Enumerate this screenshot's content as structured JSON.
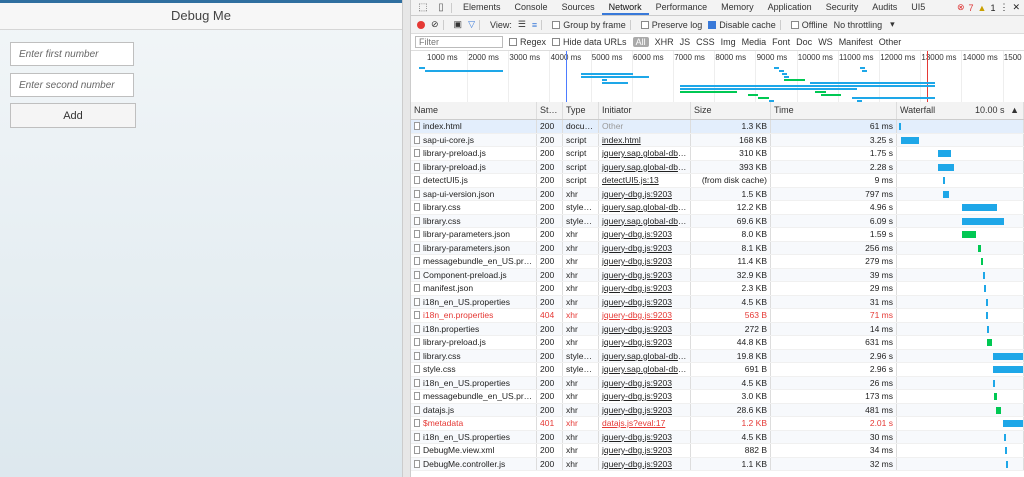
{
  "app": {
    "title": "Debug Me",
    "first_placeholder": "Enter first number",
    "second_placeholder": "Enter second number",
    "add_label": "Add"
  },
  "devtools": {
    "tabs": [
      "Elements",
      "Console",
      "Sources",
      "Network",
      "Performance",
      "Memory",
      "Application",
      "Security",
      "Audits",
      "UI5"
    ],
    "active_tab": "Network",
    "errors": "7",
    "warnings": "1",
    "toolbar": {
      "view_label": "View:",
      "group_by_frame": "Group by frame",
      "preserve_log": "Preserve log",
      "disable_cache": "Disable cache",
      "offline": "Offline",
      "throttling": "No throttling"
    },
    "filter": {
      "placeholder": "Filter",
      "regex": "Regex",
      "hide_data_urls": "Hide data URLs",
      "types": [
        "All",
        "XHR",
        "JS",
        "CSS",
        "Img",
        "Media",
        "Font",
        "Doc",
        "WS",
        "Manifest",
        "Other"
      ]
    },
    "overview_ticks": [
      "1000 ms",
      "2000 ms",
      "3000 ms",
      "4000 ms",
      "5000 ms",
      "6000 ms",
      "7000 ms",
      "8000 ms",
      "9000 ms",
      "10000 ms",
      "11000 ms",
      "12000 ms",
      "13000 ms",
      "14000 ms",
      "1500"
    ],
    "columns": {
      "name": "Name",
      "status": "Stat...",
      "type": "Type",
      "initiator": "Initiator",
      "size": "Size",
      "time": "Time",
      "waterfall": "Waterfall",
      "waterfall_tick": "10.00 s"
    },
    "requests": [
      {
        "name": "index.html",
        "status": "200",
        "type": "docum...",
        "initiator": "Other",
        "size": "1.3 KB",
        "time": "61 ms",
        "wf_start": 0.8,
        "wf_len": 1.2,
        "color": "#1ea7e8"
      },
      {
        "name": "sap-ui-core.js",
        "status": "200",
        "type": "script",
        "initiator": "index.html",
        "size": "168 KB",
        "time": "3.25 s",
        "wf_start": 2,
        "wf_len": 15,
        "color": "#1ea7e8"
      },
      {
        "name": "library-preload.js",
        "status": "200",
        "type": "script",
        "initiator": "jquery.sap.global-dbg.j...",
        "size": "310 KB",
        "time": "1.75 s",
        "wf_start": 32,
        "wf_len": 10,
        "color": "#1ea7e8"
      },
      {
        "name": "library-preload.js",
        "status": "200",
        "type": "script",
        "initiator": "jquery.sap.global-dbg.j...",
        "size": "393 KB",
        "time": "2.28 s",
        "wf_start": 32,
        "wf_len": 13,
        "color": "#1ea7e8"
      },
      {
        "name": "detectUI5.js",
        "status": "200",
        "type": "script",
        "initiator": "detectUI5.js:13",
        "size": "(from disk cache)",
        "time": "9 ms",
        "wf_start": 36,
        "wf_len": 1,
        "color": "#1ea7e8"
      },
      {
        "name": "sap-ui-version.json",
        "status": "200",
        "type": "xhr",
        "initiator": "jquery-dbg.js:9203",
        "size": "1.5 KB",
        "time": "797 ms",
        "wf_start": 36,
        "wf_len": 5,
        "color": "#1ea7e8"
      },
      {
        "name": "library.css",
        "status": "200",
        "type": "stylesh...",
        "initiator": "jquery.sap.global-dbg.j...",
        "size": "12.2 KB",
        "time": "4.96 s",
        "wf_start": 51,
        "wf_len": 28,
        "color": "#1ea7e8"
      },
      {
        "name": "library.css",
        "status": "200",
        "type": "stylesh...",
        "initiator": "jquery.sap.global-dbg.j...",
        "size": "69.6 KB",
        "time": "6.09 s",
        "wf_start": 51,
        "wf_len": 34,
        "color": "#1ea7e8"
      },
      {
        "name": "library-parameters.json",
        "status": "200",
        "type": "xhr",
        "initiator": "jquery-dbg.js:9203",
        "size": "8.0 KB",
        "time": "1.59 s",
        "wf_start": 51,
        "wf_len": 11,
        "color": "#00c853"
      },
      {
        "name": "library-parameters.json",
        "status": "200",
        "type": "xhr",
        "initiator": "jquery-dbg.js:9203",
        "size": "8.1 KB",
        "time": "256 ms",
        "wf_start": 64,
        "wf_len": 2,
        "color": "#00c853"
      },
      {
        "name": "messagebundle_en_US.proper...",
        "status": "200",
        "type": "xhr",
        "initiator": "jquery-dbg.js:9203",
        "size": "11.4 KB",
        "time": "279 ms",
        "wf_start": 66,
        "wf_len": 2,
        "color": "#00c853"
      },
      {
        "name": "Component-preload.js",
        "status": "200",
        "type": "xhr",
        "initiator": "jquery-dbg.js:9203",
        "size": "32.9 KB",
        "time": "39 ms",
        "wf_start": 68,
        "wf_len": 1,
        "color": "#1ea7e8"
      },
      {
        "name": "manifest.json",
        "status": "200",
        "type": "xhr",
        "initiator": "jquery-dbg.js:9203",
        "size": "2.3 KB",
        "time": "29 ms",
        "wf_start": 69,
        "wf_len": 1,
        "color": "#1ea7e8"
      },
      {
        "name": "i18n_en_US.properties",
        "status": "200",
        "type": "xhr",
        "initiator": "jquery-dbg.js:9203",
        "size": "4.5 KB",
        "time": "31 ms",
        "wf_start": 70,
        "wf_len": 1,
        "color": "#1ea7e8"
      },
      {
        "name": "i18n_en.properties",
        "status": "404",
        "type": "xhr",
        "initiator": "jquery-dbg.js:9203",
        "size": "563 B",
        "time": "71 ms",
        "wf_start": 70.5,
        "wf_len": 1,
        "color": "#1ea7e8",
        "error": true
      },
      {
        "name": "i18n.properties",
        "status": "200",
        "type": "xhr",
        "initiator": "jquery-dbg.js:9203",
        "size": "272 B",
        "time": "14 ms",
        "wf_start": 71,
        "wf_len": 1,
        "color": "#1ea7e8"
      },
      {
        "name": "library-preload.js",
        "status": "200",
        "type": "xhr",
        "initiator": "jquery-dbg.js:9203",
        "size": "44.8 KB",
        "time": "631 ms",
        "wf_start": 71,
        "wf_len": 4,
        "color": "#00c853"
      },
      {
        "name": "library.css",
        "status": "200",
        "type": "stylesh...",
        "initiator": "jquery.sap.global-dbg.j...",
        "size": "19.8 KB",
        "time": "2.96 s",
        "wf_start": 76,
        "wf_len": 24,
        "color": "#1ea7e8"
      },
      {
        "name": "style.css",
        "status": "200",
        "type": "stylesh...",
        "initiator": "jquery.sap.global-dbg.j...",
        "size": "691 B",
        "time": "2.96 s",
        "wf_start": 76,
        "wf_len": 24,
        "color": "#1ea7e8"
      },
      {
        "name": "i18n_en_US.properties",
        "status": "200",
        "type": "xhr",
        "initiator": "jquery-dbg.js:9203",
        "size": "4.5 KB",
        "time": "26 ms",
        "wf_start": 76,
        "wf_len": 1,
        "color": "#1ea7e8"
      },
      {
        "name": "messagebundle_en_US.proper...",
        "status": "200",
        "type": "xhr",
        "initiator": "jquery-dbg.js:9203",
        "size": "3.0 KB",
        "time": "173 ms",
        "wf_start": 77,
        "wf_len": 2,
        "color": "#00c853"
      },
      {
        "name": "datajs.js",
        "status": "200",
        "type": "xhr",
        "initiator": "jquery-dbg.js:9203",
        "size": "28.6 KB",
        "time": "481 ms",
        "wf_start": 78,
        "wf_len": 4,
        "color": "#00c853"
      },
      {
        "name": "$metadata",
        "status": "401",
        "type": "xhr",
        "initiator": "datajs.js?eval:17",
        "size": "1.2 KB",
        "time": "2.01 s",
        "wf_start": 84,
        "wf_len": 16,
        "color": "#1ea7e8",
        "error": true
      },
      {
        "name": "i18n_en_US.properties",
        "status": "200",
        "type": "xhr",
        "initiator": "jquery-dbg.js:9203",
        "size": "4.5 KB",
        "time": "30 ms",
        "wf_start": 85,
        "wf_len": 1,
        "color": "#1ea7e8"
      },
      {
        "name": "DebugMe.view.xml",
        "status": "200",
        "type": "xhr",
        "initiator": "jquery-dbg.js:9203",
        "size": "882 B",
        "time": "34 ms",
        "wf_start": 85.5,
        "wf_len": 1,
        "color": "#1ea7e8"
      },
      {
        "name": "DebugMe.controller.js",
        "status": "200",
        "type": "xhr",
        "initiator": "jquery-dbg.js:9203",
        "size": "1.1 KB",
        "time": "32 ms",
        "wf_start": 86,
        "wf_len": 1,
        "color": "#1ea7e8"
      }
    ]
  }
}
